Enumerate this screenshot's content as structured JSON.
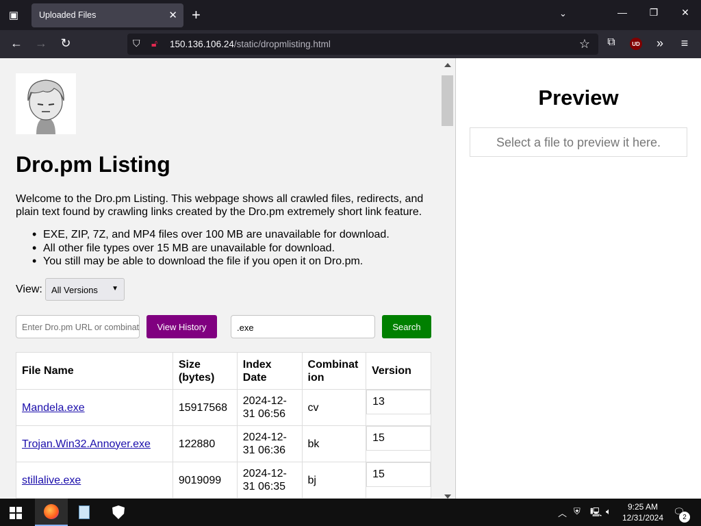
{
  "browser": {
    "tab_title": "Uploaded Files",
    "url_host": "150.136.106.24",
    "url_path": "/static/dropmlisting.html",
    "extension_badge": "UD"
  },
  "page": {
    "title": "Dro.pm Listing",
    "intro": "Welcome to the Dro.pm Listing. This webpage shows all crawled files, redirects, and plain text found by crawling links created by the Dro.pm extremely short link feature.",
    "notes": [
      "EXE, ZIP, 7Z, and MP4 files over 100 MB are unavailable for download.",
      "All other file types over 15 MB are unavailable for download.",
      "You still may be able to download the file if you open it on Dro.pm."
    ],
    "view_label": "View:",
    "view_selected": "All Versions",
    "url_input_placeholder": "Enter Dro.pm URL or combination",
    "history_button": "View History",
    "search_value": ".exe",
    "search_button": "Search",
    "table": {
      "headers": [
        "File Name",
        "Size (bytes)",
        "Index Date",
        "Combination",
        "Version"
      ],
      "rows": [
        {
          "name": "Mandela.exe",
          "size": "15917568",
          "date": "2024-12-31 06:56",
          "combo": "cv",
          "version": "13"
        },
        {
          "name": "Trojan.Win32.Annoyer.exe",
          "size": "122880",
          "date": "2024-12-31 06:36",
          "combo": "bk",
          "version": "15"
        },
        {
          "name": "stillalive.exe",
          "size": "9019099",
          "date": "2024-12-31 06:35",
          "combo": "bj",
          "version": "15"
        }
      ]
    }
  },
  "preview": {
    "title": "Preview",
    "placeholder": "Select a file to preview it here."
  },
  "taskbar": {
    "time": "9:25 AM",
    "date": "12/31/2024",
    "notification_count": "2"
  }
}
